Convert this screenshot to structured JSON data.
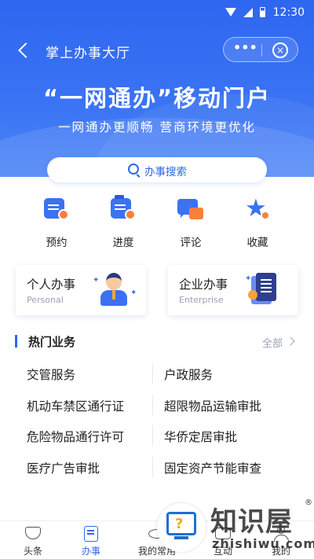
{
  "status_bar": {
    "time": "12:30"
  },
  "nav": {
    "title": "掌上办事大厅",
    "more": "•••",
    "close": "×"
  },
  "hero": {
    "title": "“一网通办”移动门户",
    "subtitle": "一网通办更顺畅 营商环境更优化"
  },
  "search": {
    "label": "办事搜索"
  },
  "quick_actions": [
    {
      "label": "预约",
      "icon": "calendar-document-icon"
    },
    {
      "label": "进度",
      "icon": "progress-search-icon"
    },
    {
      "label": "评论",
      "icon": "comment-icon"
    },
    {
      "label": "收藏",
      "icon": "star-icon"
    }
  ],
  "cards": [
    {
      "title": "个人办事",
      "subtitle": "Personal",
      "icon": "person-icon"
    },
    {
      "title": "企业办事",
      "subtitle": "Enterprise",
      "icon": "enterprise-document-icon"
    }
  ],
  "hot_section": {
    "title": "热门业务",
    "all_label": "全部",
    "items": [
      [
        "交管服务",
        "户政服务"
      ],
      [
        "机动车禁区通行证",
        "超限物品运输审批"
      ],
      [
        "危险物品通行许可",
        "华侨定居审批"
      ],
      [
        "医疗广告审批",
        "固定资产节能审查"
      ]
    ]
  },
  "tabbar": [
    {
      "label": "头条",
      "icon": "gem-icon"
    },
    {
      "label": "办事",
      "icon": "document-clock-icon"
    },
    {
      "label": "我的常用",
      "icon": "eye-icon"
    },
    {
      "label": "互动",
      "icon": "chat-icon"
    },
    {
      "label": "我的",
      "icon": "user-icon"
    }
  ],
  "watermark": {
    "brand": "知识屋",
    "domain": "zhishiwu.com",
    "registered": "®"
  },
  "colors": {
    "primary": "#2f66f0",
    "accent_orange": "#f7803a",
    "text": "#222222",
    "muted": "#9aa3b2"
  }
}
